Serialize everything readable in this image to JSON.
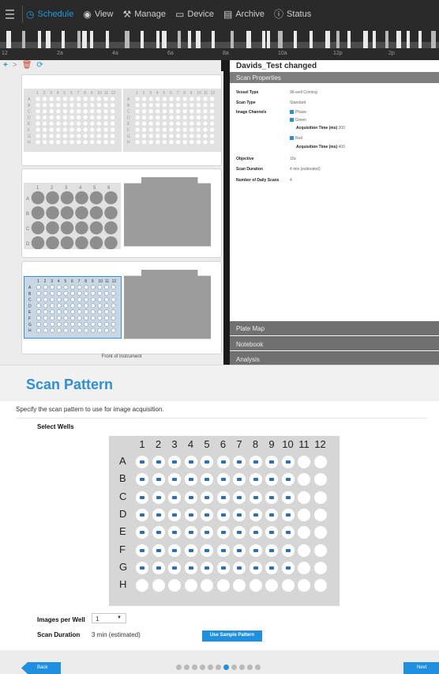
{
  "nav": {
    "items": [
      {
        "label": "Schedule",
        "icon": "clock-icon",
        "active": true
      },
      {
        "label": "View",
        "icon": "eye-icon",
        "active": false
      },
      {
        "label": "Manage",
        "icon": "wrench-icon",
        "active": false
      },
      {
        "label": "Device",
        "icon": "device-icon",
        "active": false
      },
      {
        "label": "Archive",
        "icon": "archive-icon",
        "active": false
      },
      {
        "label": "Status",
        "icon": "info-icon",
        "active": false
      }
    ]
  },
  "timeline": {
    "labels": [
      "12",
      "2a",
      "4a",
      "6a",
      "8a",
      "10a",
      "12p",
      "2p"
    ]
  },
  "toolbar": {
    "add": "+",
    "forward": ">",
    "delete": "🗑",
    "refresh": "⟳"
  },
  "vessel": {
    "front_label": "Front of Instrument",
    "plate_cols": [
      "1",
      "2",
      "3",
      "4",
      "5",
      "6",
      "7",
      "8",
      "9",
      "10",
      "11",
      "12"
    ],
    "plate_rows": [
      "A",
      "B",
      "C",
      "D",
      "E",
      "F",
      "G",
      "H"
    ],
    "six_cols": [
      "1",
      "2",
      "3",
      "4",
      "5",
      "6"
    ],
    "six_rows": [
      "A",
      "B",
      "C",
      "D"
    ]
  },
  "experiment": {
    "title": "Davids_Test changed",
    "section": "Scan Properties",
    "vessel_type_key": "Vessel Type",
    "vessel_type": "96-well Corning",
    "scan_type_key": "Scan Type",
    "scan_type": "Standard",
    "channels_key": "Image Channels",
    "ch_phase": "Phase",
    "ch_green": "Green",
    "acq_label": "Acquisition Time (ms)",
    "acq_green": "300",
    "ch_red": "Red",
    "acq_red": "400",
    "objective_key": "Objective",
    "objective": "10x",
    "duration_key": "Scan Duration",
    "duration": "4 min (estimated)",
    "daily_key": "Number of Daily Scans",
    "daily": "4",
    "accordion": [
      "Plate Map",
      "Notebook",
      "Analysis"
    ]
  },
  "wizard": {
    "title": "Scan Pattern",
    "subtitle": "Specify the scan pattern to use for image acquisition.",
    "select_wells": "Select Wells",
    "cols": [
      "1",
      "2",
      "3",
      "4",
      "5",
      "6",
      "7",
      "8",
      "9",
      "10",
      "11",
      "12"
    ],
    "rows": [
      "A",
      "B",
      "C",
      "D",
      "E",
      "F",
      "G",
      "H"
    ],
    "checked_rows": 7,
    "checked_cols": 10,
    "images_label": "Images per Well",
    "images_value": "1",
    "duration_label": "Scan Duration",
    "duration_value": "3 min (estimated)",
    "sample_button": "Use Sample Pattern",
    "back": "Back",
    "next": "Next",
    "steps": 11,
    "current_step": 7
  },
  "colors": {
    "accent": "#1f8fe0",
    "dark": "#2a2a2a",
    "panel": "#707070"
  }
}
